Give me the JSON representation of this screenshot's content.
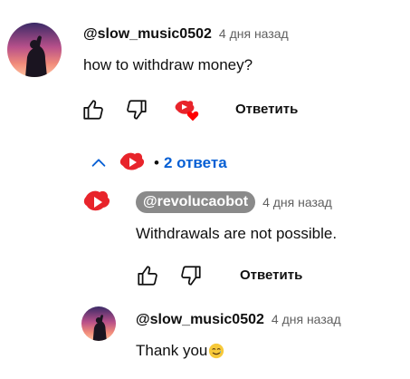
{
  "thread": {
    "comment": {
      "author": "@slow_music0502",
      "time": "4 дня назад",
      "text": "how to withdraw money?",
      "reply_label": "Ответить"
    },
    "replies_toggle": {
      "label": "2 ответа",
      "bullet": "•"
    },
    "replies": [
      {
        "author": "@revolucaobot",
        "time": "4 дня назад",
        "text": "Withdrawals are not possible.",
        "reply_label": "Ответить"
      },
      {
        "author": "@slow_music0502",
        "time": "4 дня назад",
        "text": "Thank you",
        "emoji": "smiling-face-with-tear"
      }
    ]
  },
  "colors": {
    "link_blue": "#065fd4",
    "creator_red": "#e8242b",
    "heart_red": "#ff0000",
    "chip_gray": "#8a8a8a",
    "meta_gray": "#606060"
  }
}
